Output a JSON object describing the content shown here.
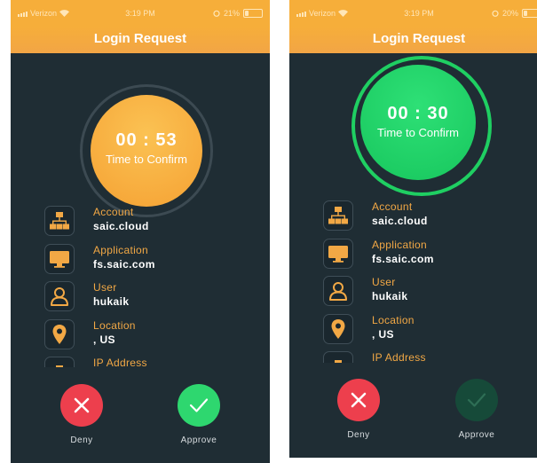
{
  "status": {
    "carrier": "Verizon",
    "time": "3:19 PM"
  },
  "screens": [
    {
      "battery": "21%",
      "battery_level": 0.21,
      "title": "Login Request",
      "countdown": "00 : 53",
      "countdown_label": "Time to Confirm"
    },
    {
      "battery": "20%",
      "battery_level": 0.2,
      "title": "Login Request",
      "countdown": "00 : 30",
      "countdown_label": "Time to Confirm"
    }
  ],
  "details": {
    "account_label": "Account",
    "account_value": "saic.cloud",
    "application_label": "Application",
    "application_value": "fs.saic.com",
    "user_label": "User",
    "user_value": "hukaik",
    "location_label": "Location",
    "location_value": ", US",
    "ip_label": "IP Address"
  },
  "actions": {
    "deny": "Deny",
    "approve": "Approve"
  },
  "icons": {
    "account": "org-chart-icon",
    "application": "monitor-icon",
    "user": "user-icon",
    "location": "map-pin-icon",
    "ip": "network-icon",
    "deny": "close-icon",
    "approve": "check-icon"
  },
  "colors": {
    "header": "#f6ae3a",
    "background": "#1f2d34",
    "accent": "#f2a845",
    "timer_orange": "#f9b040",
    "timer_green": "#20d468",
    "deny": "#ed3f4d",
    "approve": "#2ed76f",
    "approve_disabled": "#164a39"
  }
}
